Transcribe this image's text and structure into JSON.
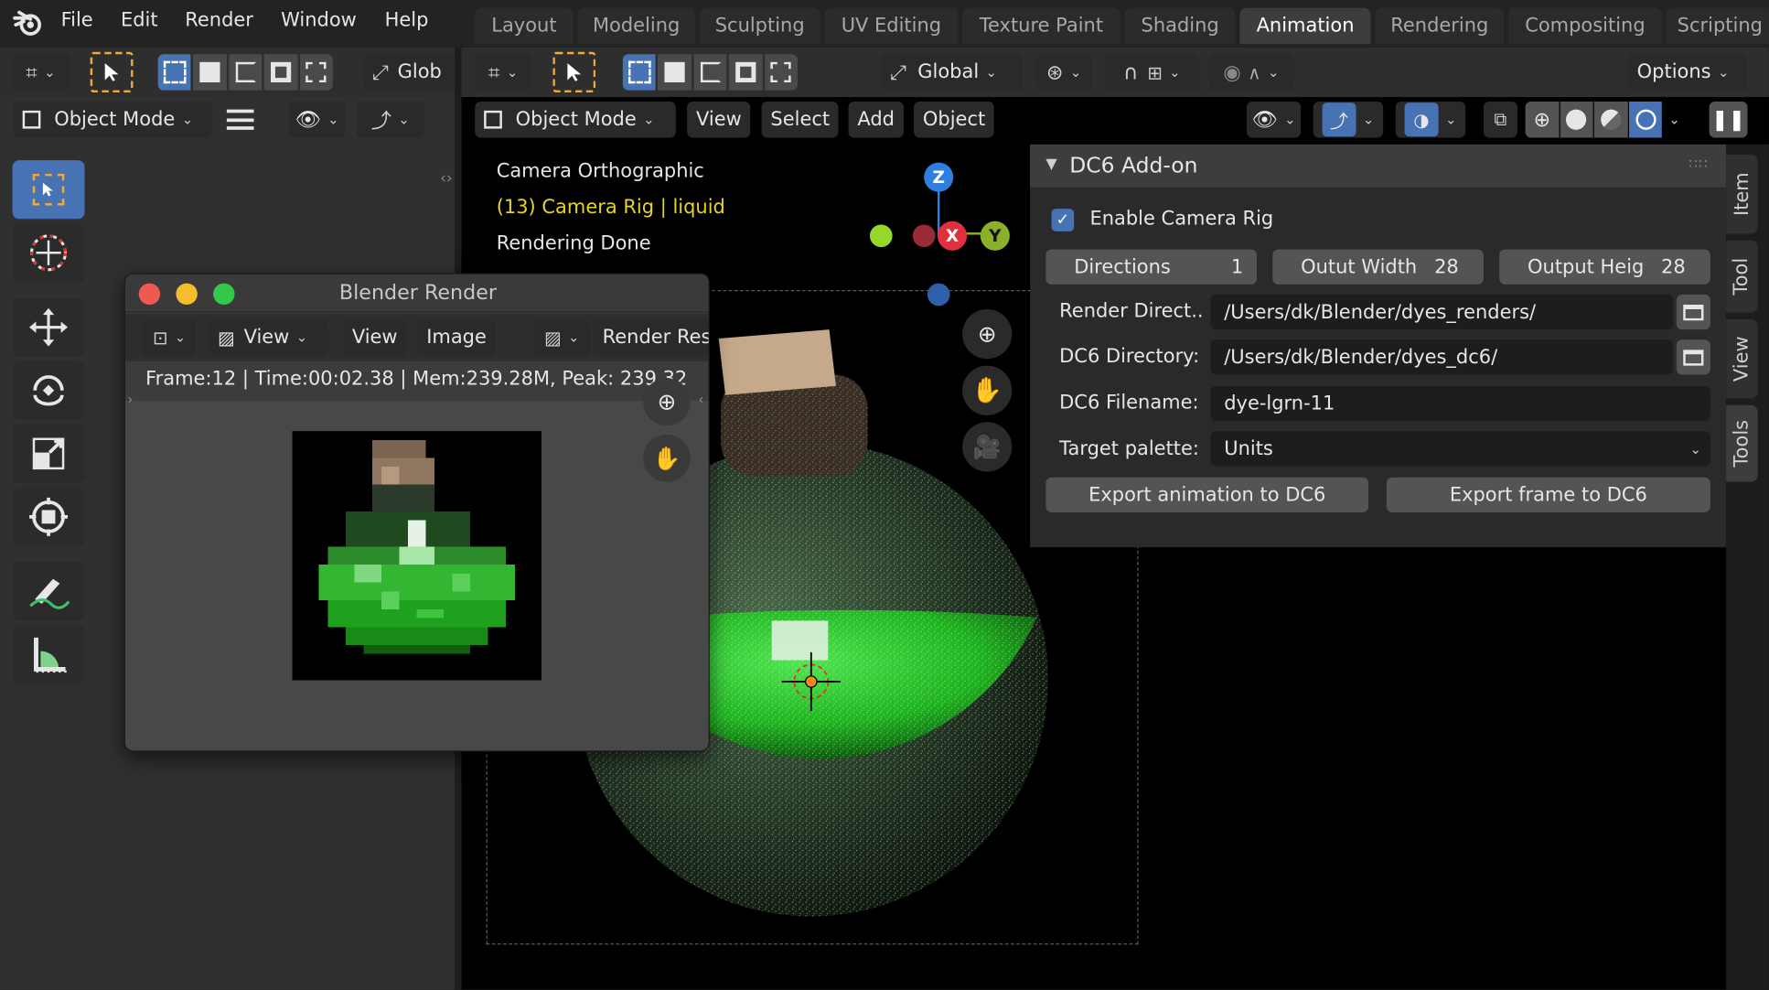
{
  "topbar": {
    "menus": [
      "File",
      "Edit",
      "Render",
      "Window",
      "Help"
    ],
    "workspaces": [
      "Layout",
      "Modeling",
      "Sculpting",
      "UV Editing",
      "Texture Paint",
      "Shading",
      "Animation",
      "Rendering",
      "Compositing",
      "Scripting"
    ],
    "active_workspace": "Animation"
  },
  "left_editor": {
    "transform_orientation": "Glob",
    "mode": "Object Mode"
  },
  "viewport": {
    "transform_orientation": "Global",
    "options_label": "Options",
    "mode": "Object Mode",
    "menus": [
      "View",
      "Select",
      "Add",
      "Object"
    ],
    "overlay_text": {
      "line1": "Camera Orthographic",
      "line2": "(13) Camera Rig | liquid",
      "line3": "Rendering Done"
    },
    "gizmo": {
      "z": "Z",
      "x": "X",
      "y": "Y"
    },
    "colors": {
      "overlay_highlight": "#e6d32a",
      "axis_x": "#e0303e",
      "axis_y": "#8bb02a",
      "axis_z": "#2f7fe0",
      "liquid": "#2fd12f"
    }
  },
  "addon_panel": {
    "title": "DC6 Add-on",
    "enable_camera_rig": {
      "label": "Enable Camera Rig",
      "checked": true
    },
    "directions": {
      "label": "Directions",
      "value": "1"
    },
    "output_width": {
      "label": "Outut Width",
      "value": "28"
    },
    "output_height": {
      "label": "Output Heig",
      "value": "28"
    },
    "render_dir": {
      "label": "Render Direct..",
      "value": "/Users/dk/Blender/dyes_renders/"
    },
    "dc6_dir": {
      "label": "DC6 Directory:",
      "value": "/Users/dk/Blender/dyes_dc6/"
    },
    "dc6_filename": {
      "label": "DC6 Filename:",
      "value": "dye-lgrn-11"
    },
    "target_palette": {
      "label": "Target palette:",
      "value": "Units"
    },
    "export_animation": "Export animation to DC6",
    "export_frame": "Export frame to DC6"
  },
  "sidebar_tabs": [
    "Item",
    "Tool",
    "View",
    "Tools"
  ],
  "render_window": {
    "title": "Blender Render",
    "menus": [
      "View",
      "View",
      "Image"
    ],
    "slot": "Render Res",
    "stats": "Frame:12 | Time:00:02.38 | Mem:239.28M, Peak: 239.32"
  }
}
